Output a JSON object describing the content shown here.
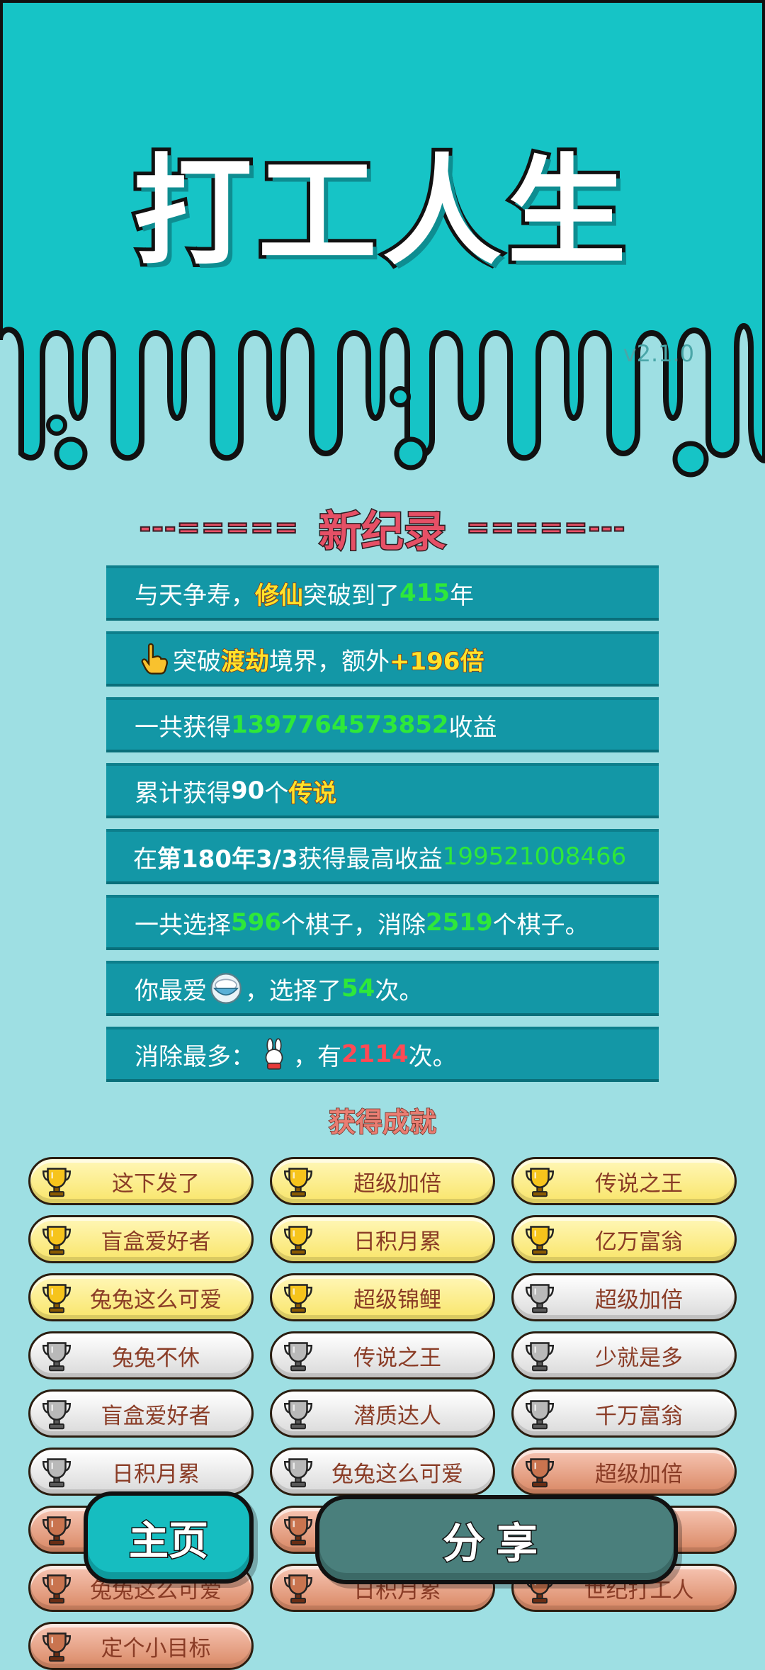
{
  "header": {
    "title": "打工人生",
    "version": "v2.1.0"
  },
  "record": {
    "left_dashes": "---=====",
    "title": "新纪录",
    "right_dashes": "=====---"
  },
  "stats": [
    {
      "pre": "与天争寿，",
      "hl1": "修仙",
      "mid": "突破到了",
      "num": "415",
      "post": "年"
    },
    {
      "pre": "突破",
      "hl1": "渡劫",
      "mid": "境界，额外",
      "num": "+196倍"
    },
    {
      "pre": "一共获得",
      "num": "1397764573852",
      "post": "收益"
    },
    {
      "pre": "累计获得",
      "num": "90",
      "mid": "个",
      "hl1": "传说"
    },
    {
      "pre": "在 ",
      "bold": "第180年3/3",
      "mid": " 获得最高收益",
      "num": "199521008466"
    },
    {
      "pre": "一共选择",
      "num": "596",
      "mid": "个棋子，消除",
      "num2": "2519",
      "post": "个棋子。"
    },
    {
      "pre": "你最爱",
      "mid": "，选择了",
      "num": "54",
      "post": "次。"
    },
    {
      "pre": "消除最多：",
      "mid": "，有",
      "num": "2114",
      "post": "次。"
    }
  ],
  "achievements": {
    "title": "获得成就",
    "items": [
      {
        "label": "这下发了",
        "tier": "gold"
      },
      {
        "label": "超级加倍",
        "tier": "gold"
      },
      {
        "label": "传说之王",
        "tier": "gold"
      },
      {
        "label": "盲盒爱好者",
        "tier": "gold"
      },
      {
        "label": "日积月累",
        "tier": "gold"
      },
      {
        "label": "亿万富翁",
        "tier": "gold"
      },
      {
        "label": "兔兔这么可爱",
        "tier": "gold"
      },
      {
        "label": "超级锦鲤",
        "tier": "gold"
      },
      {
        "label": "超级加倍",
        "tier": "silver"
      },
      {
        "label": "兔兔不休",
        "tier": "silver"
      },
      {
        "label": "传说之王",
        "tier": "silver"
      },
      {
        "label": "少就是多",
        "tier": "silver"
      },
      {
        "label": "盲盒爱好者",
        "tier": "silver"
      },
      {
        "label": "潜质达人",
        "tier": "silver"
      },
      {
        "label": "千万富翁",
        "tier": "silver"
      },
      {
        "label": "日积月累",
        "tier": "silver"
      },
      {
        "label": "兔兔这么可爱",
        "tier": "silver"
      },
      {
        "label": "超级加倍",
        "tier": "bronze"
      },
      {
        "label": "",
        "tier": "bronze"
      },
      {
        "label": "",
        "tier": "bronze"
      },
      {
        "label": "",
        "tier": "bronze"
      },
      {
        "label": "兔兔这么可爱",
        "tier": "bronze"
      },
      {
        "label": "日积月累",
        "tier": "bronze"
      },
      {
        "label": "世纪打工人",
        "tier": "bronze"
      },
      {
        "label": "定个小目标",
        "tier": "bronze"
      }
    ]
  },
  "buttons": {
    "home": "主页",
    "share": "分享"
  },
  "colors": {
    "header_bg": "#16c4c6",
    "page_bg": "#9edfe3",
    "stat_row": "#1397a6",
    "record_red": "#e65066",
    "green": "#2ee83a",
    "yellow": "#ffe22a"
  }
}
